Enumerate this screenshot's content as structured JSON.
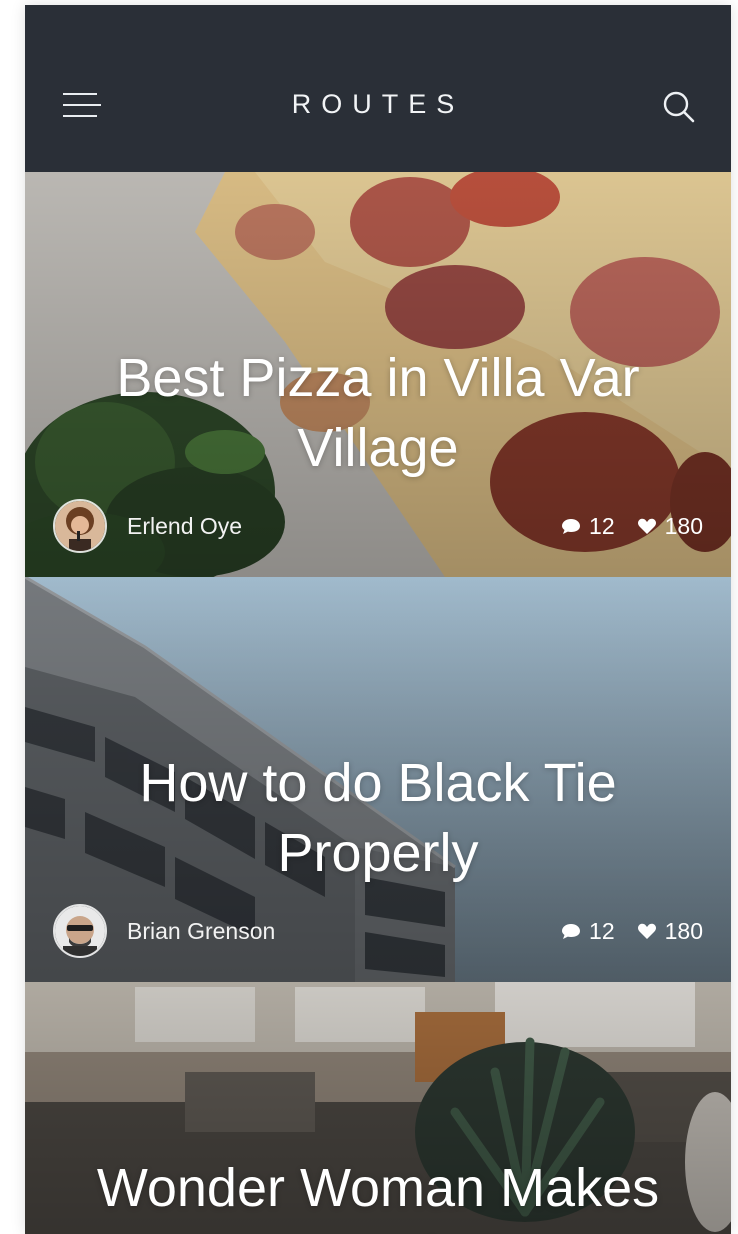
{
  "app": {
    "brand": "ROUTES"
  },
  "icons": {
    "menu": "hamburger-menu-icon",
    "search": "search-icon",
    "comment": "comment-bubble-icon",
    "like": "heart-icon"
  },
  "colors": {
    "topbar": "#2a2f37",
    "text": "#ffffff"
  },
  "posts": [
    {
      "title": "Best Pizza in Villa Var Village",
      "author": "Erlend Oye",
      "comments": "12",
      "likes": "180"
    },
    {
      "title": "How to do Black Tie Properly",
      "author": "Brian Grenson",
      "comments": "12",
      "likes": "180"
    },
    {
      "title": "Wonder Woman Makes Her Debut"
    }
  ]
}
